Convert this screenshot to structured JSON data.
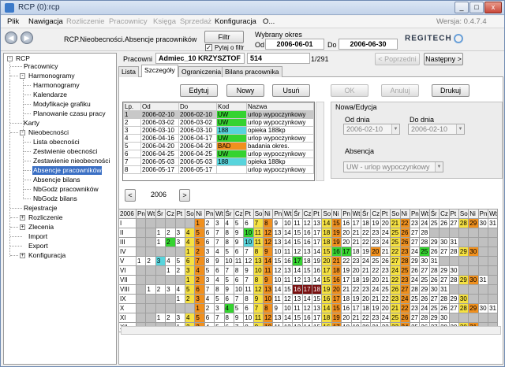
{
  "title": "RCP (0):rcp",
  "window_controls": [
    "_",
    "□",
    "x"
  ],
  "menu": {
    "items": [
      "Plik",
      "Nawigacja",
      "Rozliczenie",
      "Pracownicy",
      "Księga",
      "Sprzedaż",
      "Konfiguracja",
      "O..."
    ],
    "version": "Wersja: 0.4.7.4"
  },
  "toolbar": {
    "path": "RCP.Nieobecności.Absencje pracowników",
    "filter_button": "Filtr",
    "ask_filter": "Pytaj o filtr",
    "period_label": "Wybrany okres",
    "from_label": "Od",
    "from_value": "2006-06-01",
    "to_label": "Do",
    "to_value": "2006-06-30",
    "logo": "REGITECH"
  },
  "tree": {
    "root": "RCP",
    "items": [
      "Pracownicy",
      "Harmonogramy",
      "Harmonogramy",
      "Kalendarze",
      "Modyfikacje grafiku",
      "Planowanie czasu pracy",
      "Karty",
      "Nieobecności",
      "Lista obecności",
      "Zestwienie obecności",
      "Zestawienie nieobecności",
      "Absencje pracowników",
      "Absencje bilans",
      "NbGodz pracowników",
      "NbGodz bilans",
      "Rejestracje",
      "Rozliczenie",
      "Zlecenia",
      "Import",
      "Export",
      "Konfiguracja"
    ]
  },
  "employee": {
    "label": "Pracowni",
    "name": "Admiec_10 KRZYSZTOF",
    "id": "514",
    "counter": "1/291",
    "prev": "< Poprzedni",
    "next": "Następny >"
  },
  "tabs": [
    "Lista",
    "Szczegóły",
    "Ograniczenia",
    "Bilans pracownika"
  ],
  "actions": {
    "edit": "Edytuj",
    "new": "Nowy",
    "delete": "Usuń",
    "ok": "OK",
    "cancel": "Anuluj",
    "print": "Drukuj"
  },
  "list": {
    "columns": [
      "Lp.",
      "Od",
      "Do",
      "Kod",
      "Nazwa"
    ],
    "rows": [
      [
        "1",
        "2006-02-10",
        "2006-02-10",
        "UW",
        "urlop wypoczynkowy"
      ],
      [
        "2",
        "2006-03-02",
        "2006-03-02",
        "UW",
        "urlop wypoczynkowy"
      ],
      [
        "3",
        "2006-03-10",
        "2006-03-10",
        "188",
        "opieka 188kp"
      ],
      [
        "4",
        "2006-04-16",
        "2006-04-17",
        "UW",
        "urlop wypoczynkowy"
      ],
      [
        "5",
        "2006-04-20",
        "2006-04-20",
        "BAD",
        "badania okres."
      ],
      [
        "6",
        "2006-04-25",
        "2006-04-25",
        "UW",
        "urlop wypoczynkowy"
      ],
      [
        "7",
        "2006-05-03",
        "2006-05-03",
        "188",
        "opieka 188kp"
      ],
      [
        "8",
        "2006-05-17",
        "2006-05-17",
        "",
        "urlop wypoczynkowy"
      ]
    ]
  },
  "edit_group": {
    "title": "Nowa/Edycja",
    "from_label": "Od dnia",
    "from_value": "2006-02-10",
    "to_label": "Do dnia",
    "to_value": "2006-02-10",
    "absence_label": "Absencja",
    "absence_value": "UW - urlop wypoczynkowy"
  },
  "year": {
    "value": "2006",
    "prev": "<",
    "next": ">"
  },
  "calendar": {
    "header": [
      "2006",
      "Pn",
      "Wt",
      "Śr",
      "Cz",
      "Pt",
      "So",
      "Ni",
      "Pn",
      "Wt",
      "Śr",
      "Cz",
      "Pt",
      "So",
      "Ni",
      "Pn",
      "Wt",
      "Śr",
      "Cz",
      "Pt",
      "So",
      "Ni",
      "Pn",
      "Wt",
      "Śr",
      "Cz",
      "Pt",
      "So",
      "Ni",
      "Pn",
      "Wt",
      "Śr",
      "Cz",
      "Pt",
      "So",
      "Ni",
      "Pn",
      "Wt"
    ],
    "months": [
      {
        "m": "I",
        "off": 6,
        "days": 31,
        "hl": {
          "1": "o",
          "7": "y",
          "8": "o",
          "14": "y",
          "15": "o",
          "21": "y",
          "22": "o",
          "28": "y",
          "29": "o"
        }
      },
      {
        "m": "II",
        "off": 2,
        "days": 28,
        "hl": {
          "4": "y",
          "5": "o",
          "10": "gr",
          "11": "y",
          "12": "o",
          "18": "y",
          "19": "o",
          "25": "y",
          "26": "o"
        }
      },
      {
        "m": "III",
        "off": 2,
        "days": 31,
        "hl": {
          "2": "gr",
          "4": "y",
          "5": "o",
          "10": "c",
          "11": "y",
          "12": "o",
          "18": "y",
          "19": "o",
          "25": "y",
          "26": "o"
        }
      },
      {
        "m": "IV",
        "off": 5,
        "days": 30,
        "hl": {
          "1": "y",
          "2": "o",
          "8": "y",
          "9": "o",
          "15": "y",
          "16": "gr",
          "17": "gr",
          "20": "o",
          "22": "y",
          "23": "o",
          "25": "gr",
          "29": "y",
          "30": "o"
        }
      },
      {
        "m": "V",
        "off": 0,
        "days": 31,
        "hl": {
          "3": "c",
          "6": "y",
          "7": "o",
          "13": "y",
          "14": "o",
          "17": "gr",
          "20": "y",
          "21": "o",
          "27": "y",
          "28": "o"
        }
      },
      {
        "m": "VI",
        "off": 3,
        "days": 30,
        "hl": {
          "3": "y",
          "4": "o",
          "10": "y",
          "11": "o",
          "17": "y",
          "18": "o",
          "24": "y",
          "25": "o"
        }
      },
      {
        "m": "VII",
        "off": 5,
        "days": 31,
        "hl": {
          "1": "y",
          "2": "o",
          "8": "y",
          "9": "o",
          "15": "y",
          "16": "o",
          "22": "y",
          "23": "o",
          "29": "y",
          "30": "o"
        }
      },
      {
        "m": "VIII",
        "off": 1,
        "days": 31,
        "hl": {
          "5": "y",
          "6": "o",
          "12": "y",
          "13": "o",
          "16": "dr",
          "17": "dr",
          "18": "dr",
          "19": "y",
          "20": "o",
          "26": "y",
          "27": "o"
        }
      },
      {
        "m": "IX",
        "off": 4,
        "days": 30,
        "hl": {
          "2": "y",
          "3": "o",
          "9": "y",
          "10": "o",
          "16": "y",
          "17": "o",
          "23": "y",
          "24": "o",
          "30": "y"
        }
      },
      {
        "m": "X",
        "off": 6,
        "days": 31,
        "hl": {
          "1": "o",
          "4": "gr",
          "7": "y",
          "8": "o",
          "14": "y",
          "15": "o",
          "21": "y",
          "22": "o",
          "28": "y",
          "29": "o"
        }
      },
      {
        "m": "XI",
        "off": 2,
        "days": 30,
        "hl": {
          "4": "y",
          "5": "o",
          "11": "y",
          "12": "o",
          "18": "y",
          "19": "o",
          "25": "y",
          "26": "o"
        }
      },
      {
        "m": "XII",
        "off": 4,
        "days": 31,
        "hl": {
          "2": "y",
          "3": "o",
          "9": "y",
          "10": "o",
          "16": "y",
          "17": "o",
          "23": "y",
          "24": "o",
          "30": "y",
          "31": "o"
        }
      }
    ]
  }
}
